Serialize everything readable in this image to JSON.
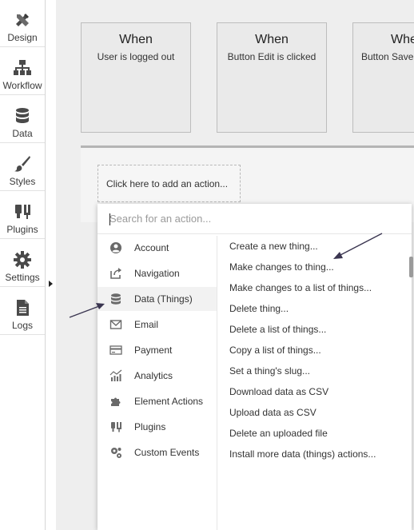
{
  "sidebar": {
    "items": [
      {
        "label": "Design",
        "icon": "design-icon"
      },
      {
        "label": "Workflow",
        "icon": "workflow-icon"
      },
      {
        "label": "Data",
        "icon": "database-icon"
      },
      {
        "label": "Styles",
        "icon": "brush-icon"
      },
      {
        "label": "Plugins",
        "icon": "plug-icon"
      },
      {
        "label": "Settings",
        "icon": "gear-icon"
      },
      {
        "label": "Logs",
        "icon": "document-icon"
      }
    ]
  },
  "events": [
    {
      "when": "When",
      "description": "User is logged out"
    },
    {
      "when": "When",
      "description": "Button Edit is clicked"
    },
    {
      "when": "When",
      "description": "Button Save is clicked"
    }
  ],
  "action_panel": {
    "add_action_label": "Click here to add an action..."
  },
  "dropdown": {
    "search_placeholder": "Search for an action...",
    "categories": [
      {
        "label": "Account",
        "icon": "account-icon"
      },
      {
        "label": "Navigation",
        "icon": "navigation-icon"
      },
      {
        "label": "Data (Things)",
        "icon": "database-icon",
        "selected": true
      },
      {
        "label": "Email",
        "icon": "email-icon"
      },
      {
        "label": "Payment",
        "icon": "credit-card-icon"
      },
      {
        "label": "Analytics",
        "icon": "analytics-icon"
      },
      {
        "label": "Element Actions",
        "icon": "puzzle-icon"
      },
      {
        "label": "Plugins",
        "icon": "plug-icon"
      },
      {
        "label": "Custom Events",
        "icon": "gears-icon"
      }
    ],
    "actions": [
      "Create a new thing...",
      "Make changes to thing...",
      "Make changes to a list of things...",
      "Delete thing...",
      "Delete a list of things...",
      "Copy a list of things...",
      "Set a thing's slug...",
      "Download data as CSV",
      "Upload data as CSV",
      "Delete an uploaded file",
      "Install more data (things) actions..."
    ]
  }
}
